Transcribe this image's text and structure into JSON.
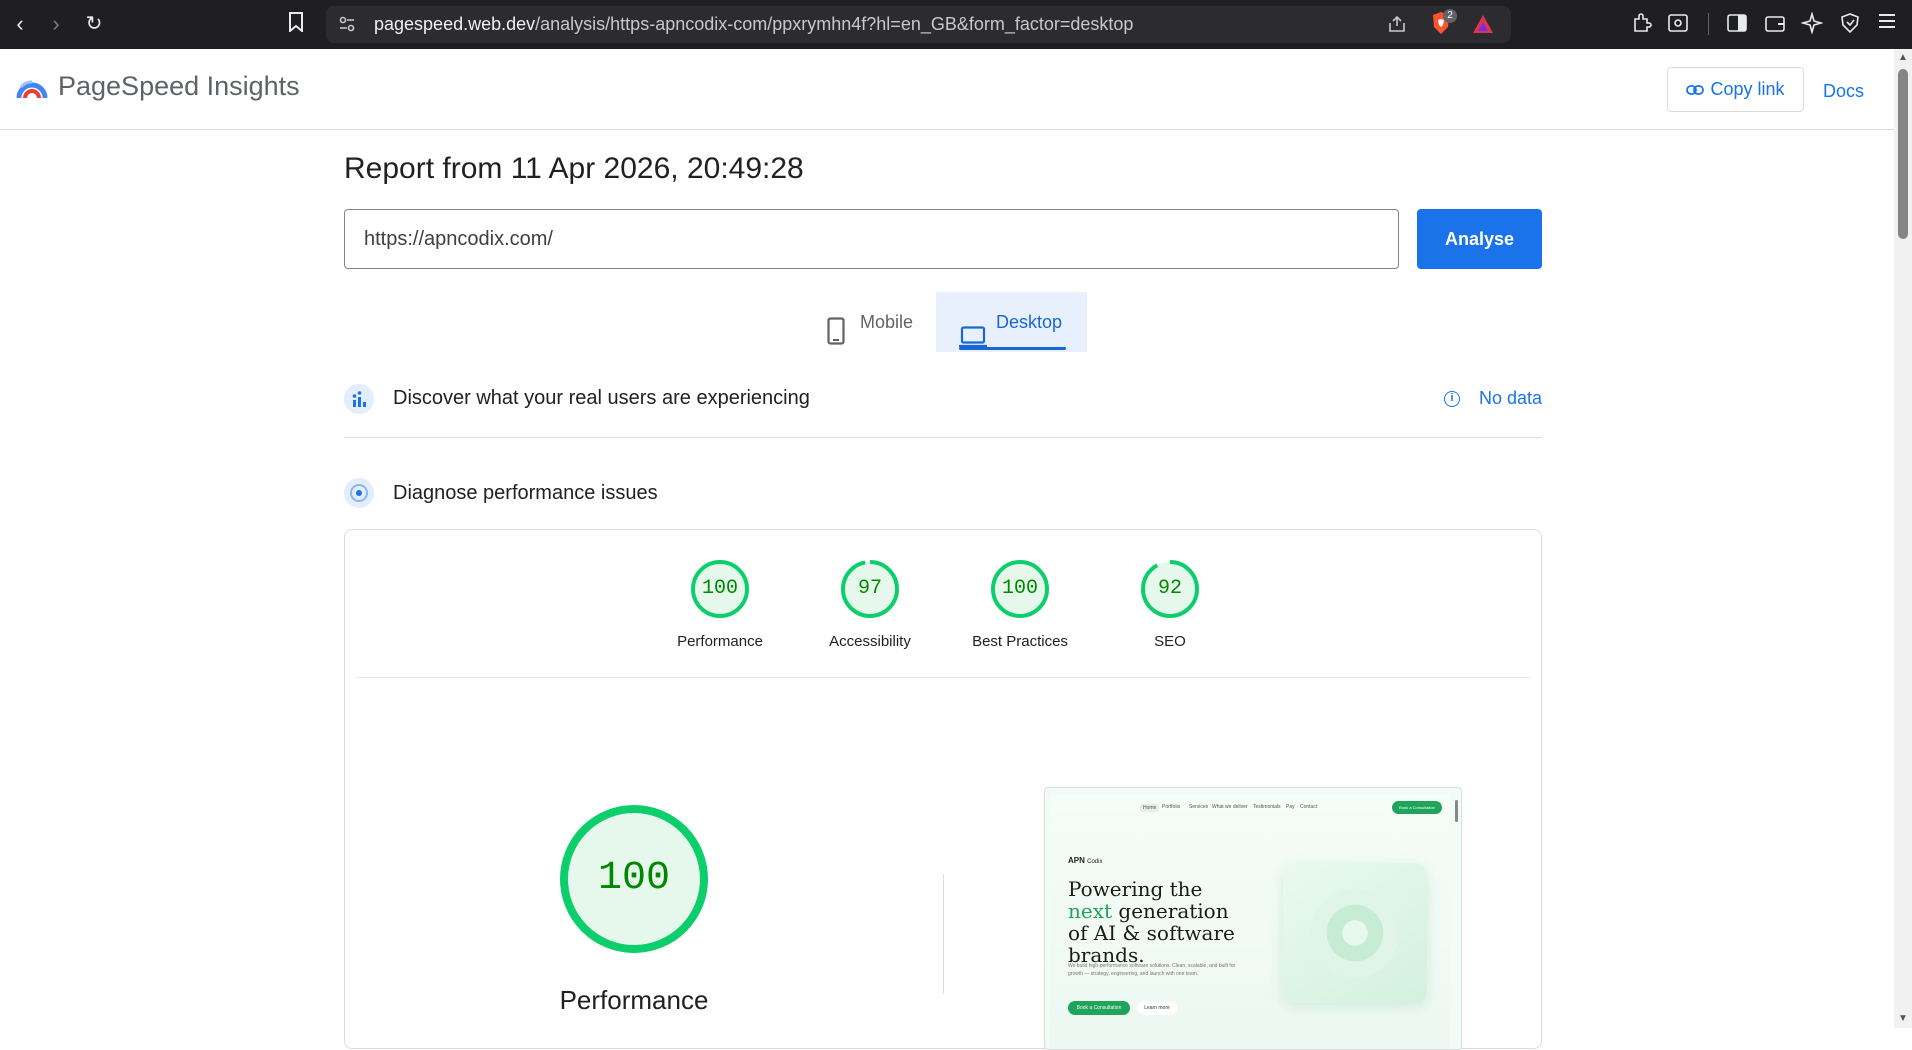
{
  "browser": {
    "url_domain": "pagespeed.web.dev",
    "url_path": "/analysis/https-apncodix-com/ppxrymhn4f?hl=en_GB&form_factor=desktop",
    "extension_badge": "2"
  },
  "header": {
    "title": "PageSpeed Insights",
    "copy_link_label": "Copy link",
    "docs_label": "Docs"
  },
  "report": {
    "title": "Report from 11 Apr 2026, 20:49:28",
    "url_value": "https://apncodix.com/",
    "analyse_label": "Analyse"
  },
  "tabs": [
    {
      "label": "Mobile",
      "active": false
    },
    {
      "label": "Desktop",
      "active": true
    }
  ],
  "sections": {
    "real_users": "Discover what your real users are experiencing",
    "no_data": "No data",
    "diagnose": "Diagnose performance issues"
  },
  "scores": [
    {
      "label": "Performance",
      "value": "100",
      "fraction": 1.0
    },
    {
      "label": "Accessibility",
      "value": "97",
      "fraction": 0.97
    },
    {
      "label": "Best Practices",
      "value": "100",
      "fraction": 1.0
    },
    {
      "label": "SEO",
      "value": "92",
      "fraction": 0.92
    }
  ],
  "main_score": {
    "label": "Performance",
    "value": "100",
    "fraction": 1.0
  },
  "colors": {
    "pass": "#0cce6b",
    "pass_fill": "#e6f8ec",
    "pass_text": "#008800",
    "accent": "#1a73e8"
  },
  "thumbnail": {
    "nav": [
      "Home",
      "Portfolio",
      "Services",
      "What we deliver",
      "Testimonials",
      "Pay",
      "Contact"
    ],
    "cta": "Book a Consultation",
    "brand": "APN",
    "brand_suffix": "Codix",
    "headline_start": "Powering the",
    "headline_accent": "next",
    "headline_end": "generation of AI & software brands.",
    "body": "We build high-performance software solutions. Clean, scalable, and built for growth — strategy, engineering, and launch with one team.",
    "btn_primary": "Book a Consultation",
    "btn_secondary": "Learn more"
  }
}
